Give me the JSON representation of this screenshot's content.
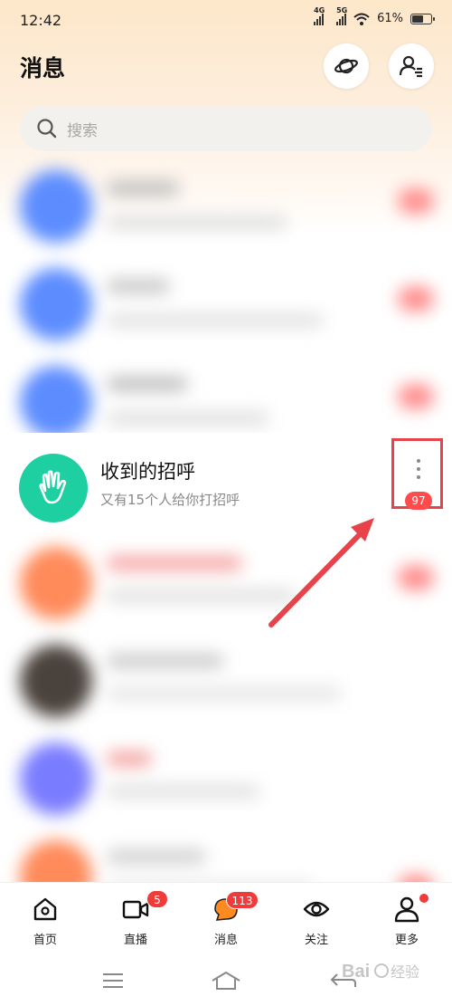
{
  "status_bar": {
    "time": "12:42",
    "signal_1_label": "4G",
    "signal_2_label": "5G",
    "battery_text": "61%",
    "battery_level": 0.61
  },
  "header": {
    "title": "消息",
    "planet_icon": "planet-icon",
    "contacts_icon": "contacts-icon"
  },
  "search": {
    "placeholder": "搜索"
  },
  "greeting_item": {
    "title": "收到的招呼",
    "subtitle": "又有15个人给你打招呼",
    "badge": "97",
    "icon": "waving-hand-icon"
  },
  "bottom_nav": {
    "items": [
      {
        "label": "首页",
        "icon": "home-icon",
        "badge": ""
      },
      {
        "label": "直播",
        "icon": "video-icon",
        "badge": "5"
      },
      {
        "label": "消息",
        "icon": "message-icon",
        "badge": "113"
      },
      {
        "label": "关注",
        "icon": "eye-icon",
        "badge": ""
      },
      {
        "label": "更多",
        "icon": "profile-icon",
        "badge": ""
      }
    ]
  },
  "colors": {
    "accent_green": "#1ecfa2",
    "badge_red": "#f03b3b",
    "annotation_red": "#e8424a",
    "message_orange": "#ff8a1f"
  }
}
